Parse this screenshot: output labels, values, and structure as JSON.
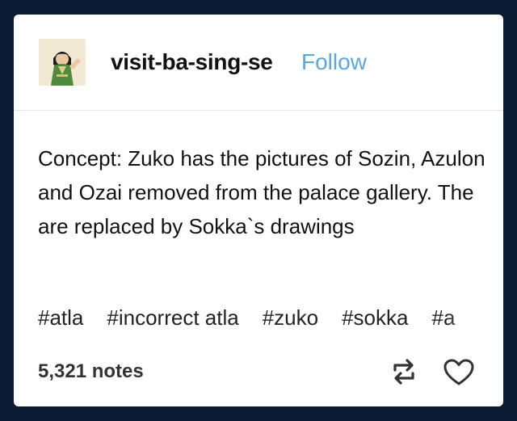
{
  "post": {
    "username": "visit-ba-sing-se",
    "follow_label": "Follow",
    "body": "Concept: Zuko has the pictures of Sozin, Azulon and Ozai removed from the palace gallery. The are replaced by Sokka`s drawings",
    "tags": [
      "#atla",
      "#incorrect atla",
      "#zuko",
      "#sokka",
      "#a"
    ],
    "notes": "5,321 notes"
  },
  "colors": {
    "background": "#0b1b33",
    "card": "#ffffff",
    "follow": "#5aa6df",
    "text": "#111111"
  },
  "icons": {
    "reblog": "reblog-icon",
    "like": "heart-icon"
  }
}
